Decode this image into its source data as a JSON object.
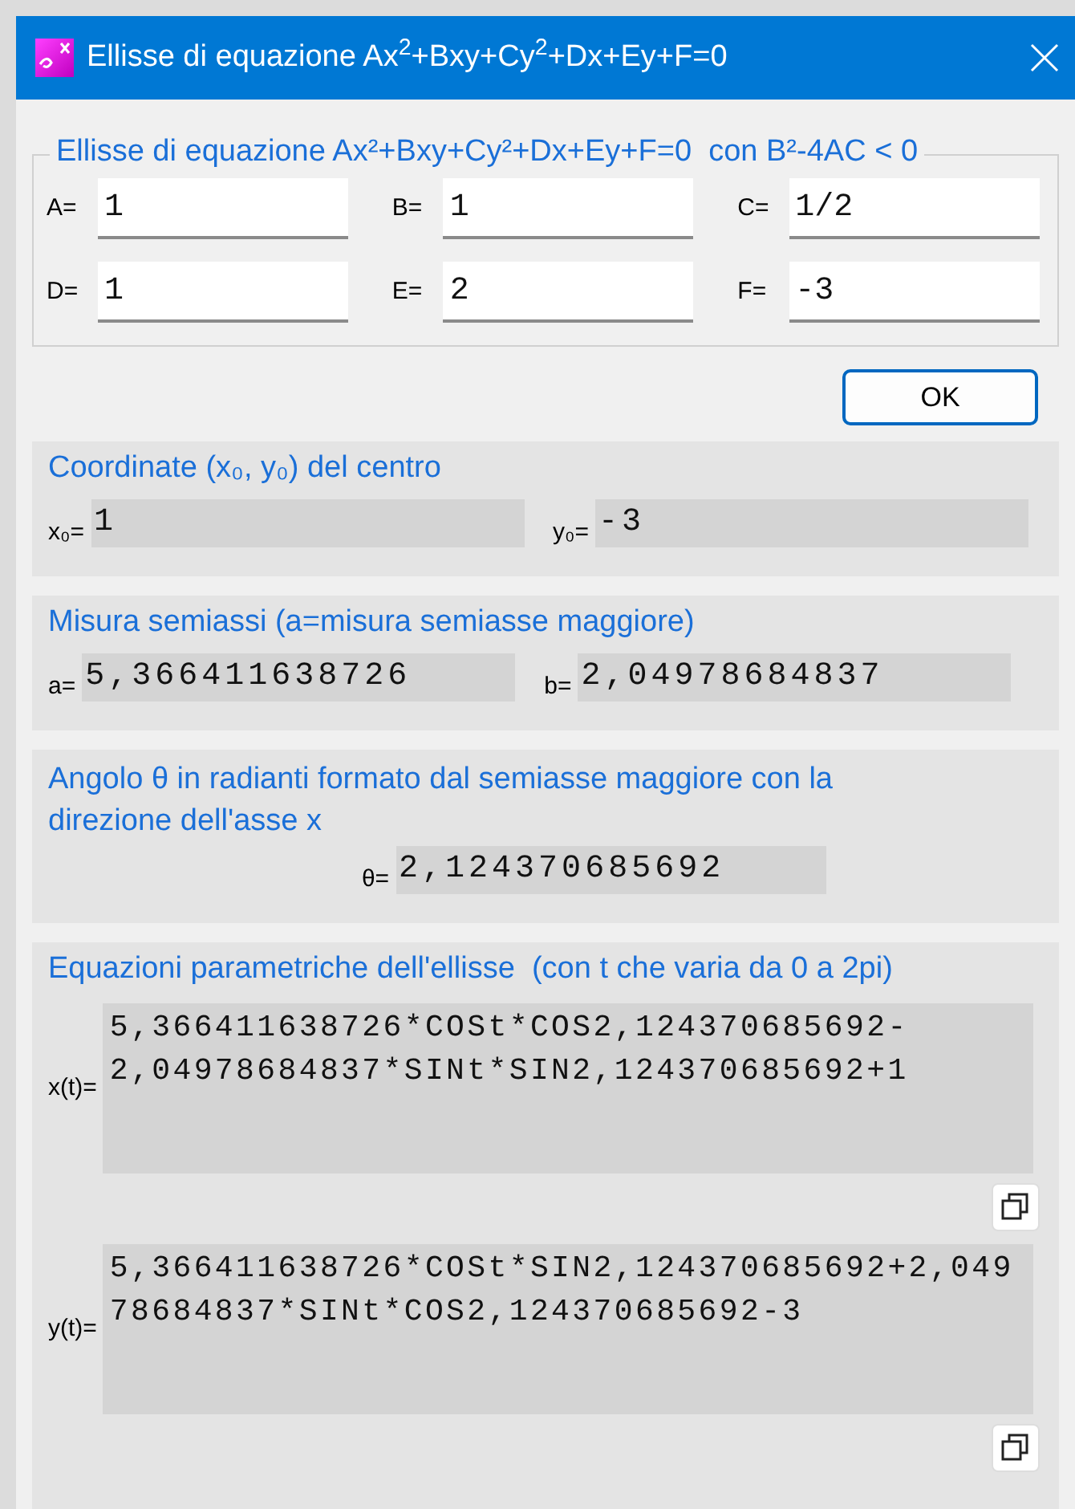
{
  "window": {
    "title": "Ellisse di equazione Ax$^{2}$+Bxy+Cy$^{2}$+Dx+Ey+F=0"
  },
  "coefficients": {
    "title": "Ellisse di equazione Ax²+Bxy+Cy²+Dx+Ey+F=0  con B²-4AC < 0",
    "fields": [
      {
        "label": "A=",
        "value": "1"
      },
      {
        "label": "B=",
        "value": "1"
      },
      {
        "label": "C=",
        "value": "1/2"
      },
      {
        "label": "D=",
        "value": "1"
      },
      {
        "label": "E=",
        "value": "2"
      },
      {
        "label": "F=",
        "value": "-3"
      }
    ]
  },
  "ok_button": "OK",
  "sections": [
    {
      "kind": "pair",
      "title": "Coordinate (x₀, y₀) del centro",
      "fields": [
        {
          "label": "x₀=",
          "value": "1"
        },
        {
          "label": "y₀=",
          "value": "-3"
        }
      ]
    },
    {
      "kind": "pair",
      "title": "Misura semiassi (a=misura semiasse maggiore)",
      "fields": [
        {
          "label": "a=",
          "value": "5,366411638726"
        },
        {
          "label": "b=",
          "value": "2,04978684837"
        }
      ]
    },
    {
      "kind": "single",
      "title": "Angolo θ in radianti formato dal semiasse maggiore con la direzione dell'asse x",
      "fields": [
        {
          "label": "θ=",
          "value": "2,124370685692"
        }
      ]
    },
    {
      "kind": "parametric",
      "title": "Equazioni parametriche dell'ellisse  (con t che varia da 0 a 2pi)",
      "fields": [
        {
          "label": "x(t)=",
          "lines": [
            "5,366411638726*COSt*COS2,124370685692-",
            "2,04978684837*SINt*SIN2,124370685692+1"
          ]
        },
        {
          "label": "y(t)=",
          "lines": [
            "5,366411638726*COSt*SIN2,124370685692+2,049",
            "78684837*SINt*COS2,124370685692-3"
          ]
        }
      ]
    }
  ]
}
